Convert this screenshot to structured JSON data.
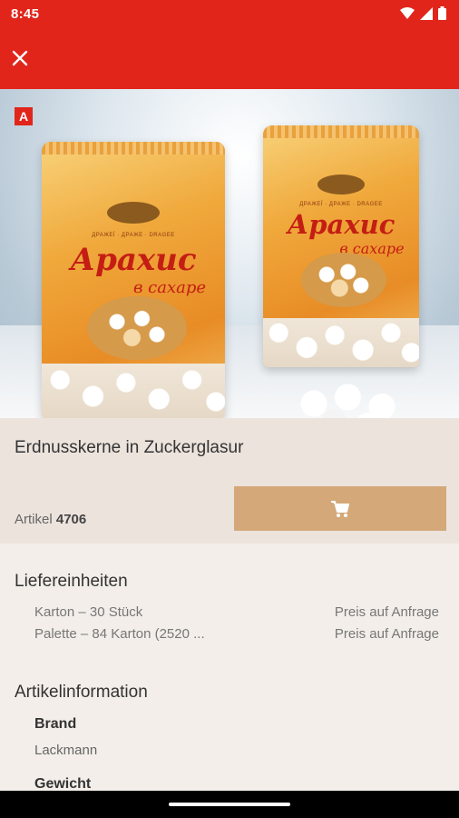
{
  "status_bar": {
    "time": "8:45",
    "icons": [
      "wifi-icon",
      "signal-icon",
      "battery-icon"
    ],
    "background": "#e1251b"
  },
  "app_bar": {
    "close_icon": "close-icon",
    "background": "#e1251b"
  },
  "hero": {
    "badge": "A",
    "package_brand_text": "Арахис",
    "package_sub_text": "в сахаре",
    "package_small_text": "ДРАЖЕЇ · ДРАЖЕ · DRAGEE"
  },
  "product": {
    "name": "Erdnusskerne in Zuckerglasur",
    "article_label": "Artikel",
    "article_number": "4706",
    "cart_icon": "cart-icon",
    "cart_color": "#d4a878"
  },
  "delivery": {
    "title": "Liefereinheiten",
    "units": [
      {
        "label": "Karton – 30 Stück",
        "price": "Preis auf Anfrage"
      },
      {
        "label": "Palette – 84 Karton (2520 ...",
        "price": "Preis auf Anfrage"
      }
    ]
  },
  "article_info": {
    "title": "Artikelinformation",
    "fields": [
      {
        "label": "Brand",
        "value": "Lackmann"
      },
      {
        "label": "Gewicht",
        "value": ""
      }
    ]
  }
}
